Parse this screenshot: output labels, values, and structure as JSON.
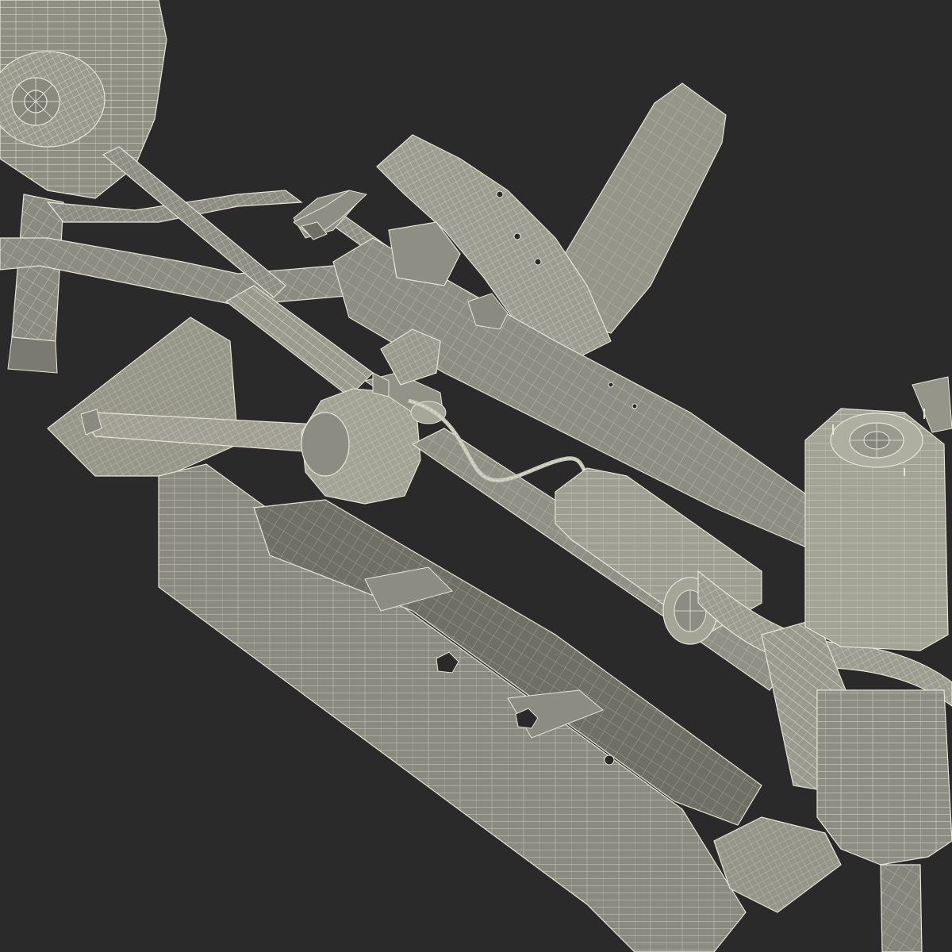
{
  "scene": {
    "subject": "wireframe-render",
    "colors": {
      "background": "#2a2a2a",
      "mesh_fill": "#8f8f84",
      "mesh_fill_light": "#a9a99c",
      "mesh_fill_dark": "#6f6f66",
      "wire": "#e6e6d6",
      "shadow": "#3a3a36"
    }
  }
}
